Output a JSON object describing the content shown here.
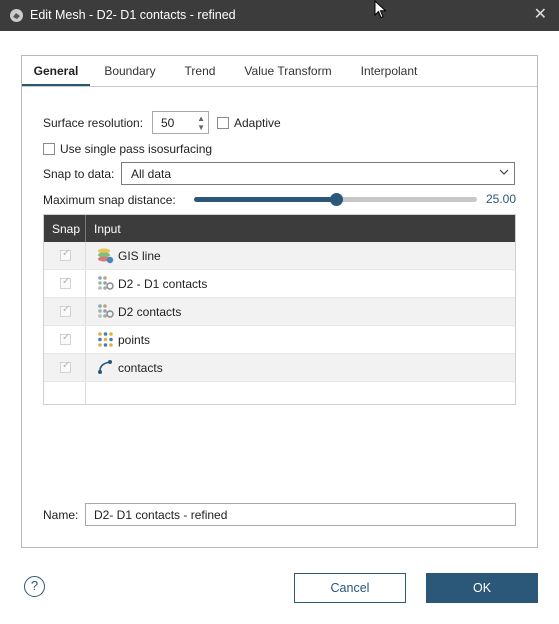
{
  "window": {
    "title": "Edit Mesh - D2- D1 contacts - refined"
  },
  "tabs": [
    {
      "label": "General"
    },
    {
      "label": "Boundary"
    },
    {
      "label": "Trend"
    },
    {
      "label": "Value Transform"
    },
    {
      "label": "Interpolant"
    }
  ],
  "general": {
    "surface_resolution": {
      "label": "Surface resolution:",
      "value": "50"
    },
    "adaptive": {
      "label": "Adaptive",
      "checked": false
    },
    "single_pass": {
      "label": "Use single pass isosurfacing",
      "checked": false
    },
    "snap_to_data": {
      "label": "Snap to data:",
      "value": "All data"
    },
    "max_snap_distance": {
      "label": "Maximum snap distance:",
      "value": "25.00",
      "fraction": 0.5
    }
  },
  "table": {
    "headers": {
      "snap": "Snap",
      "input": "Input"
    },
    "rows": [
      {
        "name": "GIS line",
        "icon": "gis-line-icon",
        "snap": true
      },
      {
        "name": "D2 - D1 contacts",
        "icon": "points-contacts-icon",
        "snap": true
      },
      {
        "name": "D2 contacts",
        "icon": "points-contacts-icon",
        "snap": true
      },
      {
        "name": "points",
        "icon": "points-icon",
        "snap": true
      },
      {
        "name": "contacts",
        "icon": "polyline-icon",
        "snap": true
      }
    ]
  },
  "name_field": {
    "label": "Name:",
    "value": "D2- D1 contacts - refined"
  },
  "buttons": {
    "help": "?",
    "cancel": "Cancel",
    "ok": "OK"
  },
  "colors": {
    "accent": "#2b5778",
    "titlebar": "#3c3c3c",
    "table_header": "#3c3c3c"
  }
}
